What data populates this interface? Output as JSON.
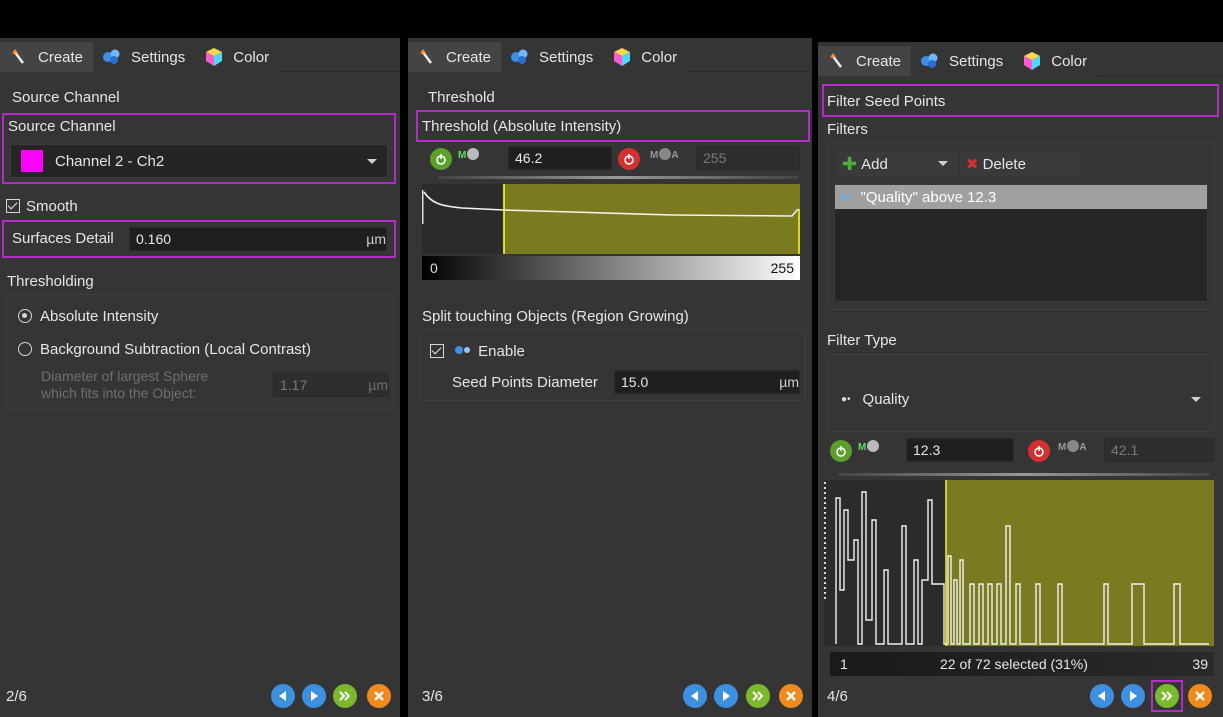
{
  "colors": {
    "highlight": "#b22cc7",
    "magenta_swatch": "#ff00ff",
    "histogram_fill": "#7a7a20",
    "threshold_line": "#ffff33"
  },
  "tabs": [
    {
      "label": "Create",
      "icon": "wand-icon"
    },
    {
      "label": "Settings",
      "icon": "settings-gem-icon"
    },
    {
      "label": "Color",
      "icon": "color-cube-icon"
    }
  ],
  "panel1": {
    "section_title": "Source Channel",
    "source_channel_label": "Source Channel",
    "channel_value": "Channel 2 - Ch2",
    "smooth_label": "Smooth",
    "surfaces_detail_label": "Surfaces Detail",
    "surfaces_detail_value": "0.160",
    "surfaces_detail_unit": "µm",
    "thresholding_title": "Thresholding",
    "radio_absolute": "Absolute Intensity",
    "radio_background": "Background Subtraction (Local Contrast)",
    "diameter_label_1": "Diameter of largest Sphere",
    "diameter_label_2": "which fits into the Object:",
    "diameter_value": "1.17",
    "diameter_unit": "µm",
    "step": "2/6"
  },
  "panel2": {
    "section_title": "Threshold",
    "threshold_label": "Threshold (Absolute Intensity)",
    "low_value": "46.2",
    "high_value": "255",
    "range_min": "0",
    "range_max": "255",
    "split_title": "Split touching Objects (Region Growing)",
    "enable_label": "Enable",
    "seed_label": "Seed Points Diameter",
    "seed_value": "15.0",
    "seed_unit": "µm",
    "step": "3/6"
  },
  "panel3": {
    "section_title": "Filter Seed Points",
    "filters_label": "Filters",
    "add_label": "Add",
    "delete_label": "Delete",
    "filter_item": "\"Quality\" above 12.3",
    "filter_type_label": "Filter Type",
    "filter_type_value": "Quality",
    "low_value": "12.3",
    "high_value": "42.1",
    "range_min": "1",
    "selected_text": "22 of 72 selected (31%)",
    "range_max": "39",
    "step": "4/6"
  }
}
